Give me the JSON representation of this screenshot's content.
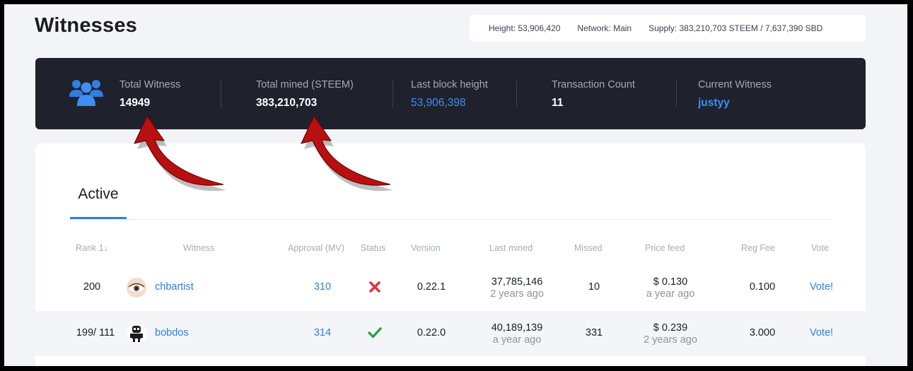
{
  "page": {
    "title": "Witnesses"
  },
  "network": {
    "height": "Height: 53,906,420",
    "network": "Network: Main",
    "supply": "Supply: 383,210,703 STEEM / 7,637,390 SBD"
  },
  "stats": {
    "icon": "users-icon",
    "total_witness_label": "Total Witness",
    "total_witness_value": "14949",
    "total_mined_label": "Total mined (STEEM)",
    "total_mined_value": "383,210,703",
    "last_block_label": "Last block height",
    "last_block_value": "53,906,398",
    "tx_count_label": "Transaction Count",
    "tx_count_value": "11",
    "current_witness_label": "Current Witness",
    "current_witness_value": "justyy"
  },
  "tabs": {
    "active": "Active"
  },
  "table": {
    "headers": {
      "rank": "Rank 1↓",
      "witness": "Witness",
      "approval": "Approval (MV)",
      "status": "Status",
      "version": "Version",
      "last_mined": "Last mined",
      "missed": "Missed",
      "price_feed": "Price feed",
      "reg_fee": "Reg Fee",
      "vote": "Vote"
    },
    "rows": [
      {
        "rank": "200",
        "witness": "chbartist",
        "approval": "310",
        "status": "inactive",
        "version": "0.22.1",
        "last_mined_block": "37,785,146",
        "last_mined_time": "2 years ago",
        "missed": "10",
        "price_feed": "$ 0.130",
        "price_feed_time": "a year ago",
        "reg_fee": "0.100",
        "vote": "Vote!"
      },
      {
        "rank": "199/ 111",
        "witness": "bobdos",
        "approval": "314",
        "status": "active",
        "version": "0.22.0",
        "last_mined_block": "40,189,139",
        "last_mined_time": "a year ago",
        "missed": "331",
        "price_feed": "$ 0.239",
        "price_feed_time": "2 years ago",
        "reg_fee": "3.000",
        "vote": "Vote!"
      }
    ]
  },
  "colors": {
    "accent": "#2f7fe0",
    "dark_panel": "#1f222d",
    "status_inactive": "#e5333f",
    "status_active": "#2ea043",
    "annotation_arrow": "#b80f10"
  }
}
